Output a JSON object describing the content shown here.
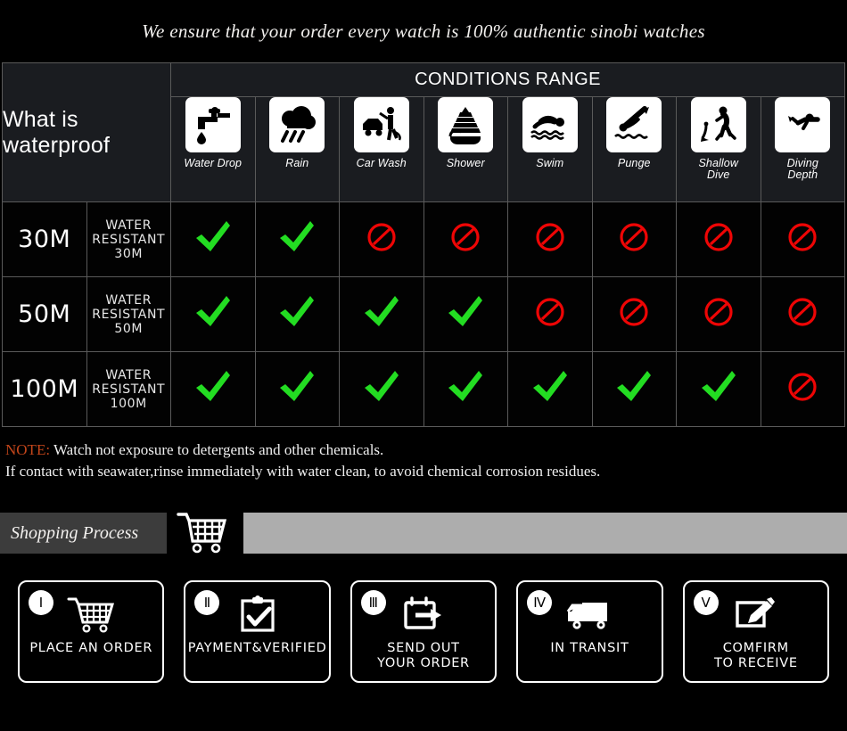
{
  "headline": "We ensure that your order every watch is 100% authentic sinobi watches",
  "table": {
    "title": "What is waterproof",
    "conditions_header": "CONDITIONS RANGE",
    "columns": [
      {
        "label": "Water Drop",
        "icon": "faucet-water-drop-icon"
      },
      {
        "label": "Rain",
        "icon": "rain-cloud-icon"
      },
      {
        "label": "Car Wash",
        "icon": "car-wash-icon"
      },
      {
        "label": "Shower",
        "icon": "shower-bathtub-icon"
      },
      {
        "label": "Swim",
        "icon": "swimmer-icon"
      },
      {
        "label": "Punge",
        "icon": "plunge-dive-icon"
      },
      {
        "label": "Shallow Dive",
        "icon": "shallow-dive-icon"
      },
      {
        "label": "Diving Depth",
        "icon": "scuba-diver-icon"
      }
    ],
    "rows": [
      {
        "depth": "30M",
        "description": "WATER RESISTANT  30M",
        "marks": [
          "yes",
          "yes",
          "no",
          "no",
          "no",
          "no",
          "no",
          "no"
        ]
      },
      {
        "depth": "50M",
        "description": "WATER RESISTANT 50M",
        "marks": [
          "yes",
          "yes",
          "yes",
          "yes",
          "no",
          "no",
          "no",
          "no"
        ]
      },
      {
        "depth": "100M",
        "description": "WATER RESISTANT  100M",
        "marks": [
          "yes",
          "yes",
          "yes",
          "yes",
          "yes",
          "yes",
          "yes",
          "no"
        ]
      }
    ]
  },
  "note": {
    "keyword": "NOTE:",
    "line1": " Watch not exposure to detergents and other chemicals.",
    "line2": "If contact with seawater,rinse immediately with water clean, to avoid chemical corrosion residues."
  },
  "process": {
    "label": "Shopping Process",
    "cart_icon": "shopping-cart-icon",
    "steps": [
      {
        "numeral": "Ⅰ",
        "label": "PLACE AN ORDER",
        "icon": "shopping-cart-icon"
      },
      {
        "numeral": "Ⅱ",
        "label": "PAYMENT&VERIFIED",
        "icon": "clipboard-check-icon"
      },
      {
        "numeral": "Ⅲ",
        "label": "SEND OUT\nYOUR ORDER",
        "icon": "calendar-arrow-icon"
      },
      {
        "numeral": "Ⅳ",
        "label": "IN TRANSIT",
        "icon": "delivery-truck-icon"
      },
      {
        "numeral": "Ⅴ",
        "label": "COMFIRM\nTO RECEIVE",
        "icon": "pencil-edit-icon"
      }
    ]
  },
  "colors": {
    "yes": "#23dd22",
    "no": "#ee0505",
    "note_keyword": "#c2451a",
    "process_bar": "#3c3c3c",
    "process_gray": "#adadad",
    "border": "#5a5a5a"
  }
}
